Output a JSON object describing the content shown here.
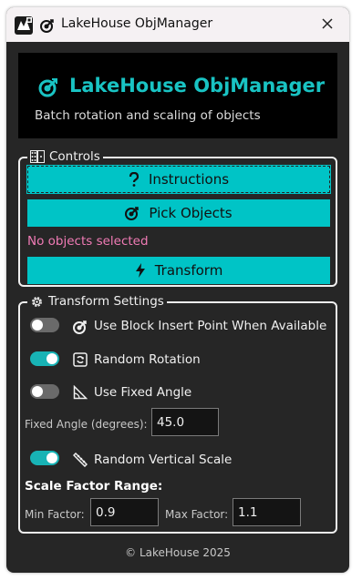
{
  "window": {
    "title": "LakeHouse ObjManager"
  },
  "header": {
    "title": "LakeHouse ObjManager",
    "subtitle": "Batch rotation and scaling of objects"
  },
  "controls": {
    "legend": "Controls",
    "instructions_label": "Instructions",
    "pick_label": "Pick Objects",
    "status": "No objects selected",
    "transform_label": "Transform"
  },
  "settings": {
    "legend": "Transform Settings",
    "use_block": {
      "label": "Use Block Insert Point When Available",
      "enabled": false
    },
    "random_rotation": {
      "label": "Random Rotation",
      "enabled": true
    },
    "fixed_angle_toggle": {
      "label": "Use Fixed Angle",
      "enabled": false
    },
    "fixed_angle": {
      "label": "Fixed Angle (degrees):",
      "value": "45.0"
    },
    "random_scale": {
      "label": "Random Vertical Scale",
      "enabled": true
    },
    "scale_range_label": "Scale Factor Range:",
    "min": {
      "label": "Min Factor:",
      "value": "0.9"
    },
    "max": {
      "label": "Max Factor:",
      "value": "1.1"
    }
  },
  "footer": {
    "text": "© LakeHouse 2025"
  },
  "colors": {
    "accent": "#00c4c6",
    "title": "#19c3c3",
    "status": "#f07bb5",
    "window_bg": "#262626"
  },
  "icons": [
    "app-icon",
    "target-icon",
    "close-icon",
    "dice-icon",
    "question-icon",
    "bolt-icon",
    "gear-icon",
    "rotate-icon",
    "angle-icon",
    "ruler-icon"
  ]
}
